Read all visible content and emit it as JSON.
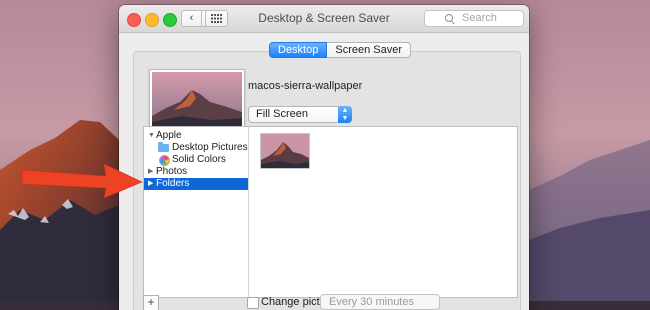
{
  "window": {
    "title": "Desktop & Screen Saver",
    "search_placeholder": "Search"
  },
  "nav": {
    "back_glyph": "‹",
    "forward_glyph": "›",
    "grid_glyph": "⋮⋮⋮"
  },
  "tabs": [
    {
      "label": "Desktop",
      "active": true
    },
    {
      "label": "Screen Saver",
      "active": false
    }
  ],
  "wallpaper": {
    "name": "macos-sierra-wallpaper",
    "fit_mode": "Fill Screen"
  },
  "sidebar": {
    "groups": [
      {
        "label": "Apple",
        "expanded": true,
        "children": [
          {
            "label": "Desktop Pictures",
            "icon": "folder-icon"
          },
          {
            "label": "Solid Colors",
            "icon": "color-wheel-icon"
          }
        ]
      },
      {
        "label": "Photos",
        "expanded": false
      },
      {
        "label": "Folders",
        "expanded": false,
        "selected": true
      }
    ]
  },
  "footer": {
    "add_label": "+",
    "change_picture_label": "Change picture:",
    "interval_value": "Every 30 minutes"
  },
  "colors": {
    "accent": "#1a82fb",
    "selection": "#0f68d8",
    "callout_arrow": "#ee4224"
  }
}
